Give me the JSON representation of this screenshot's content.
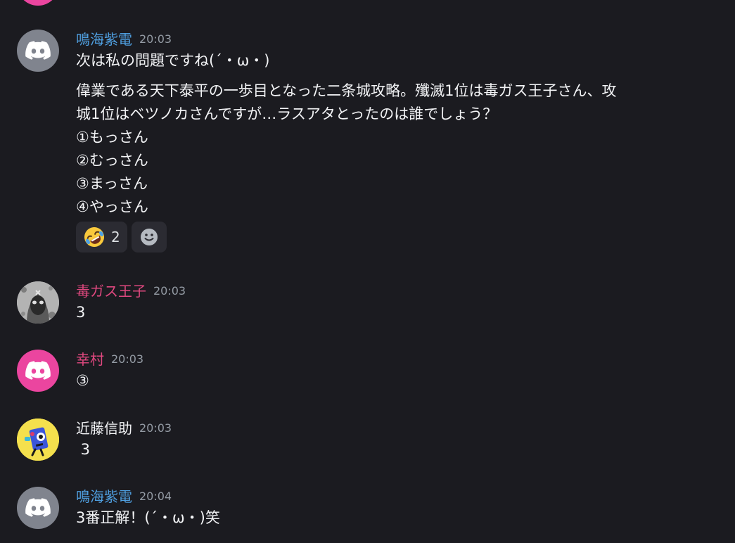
{
  "colors": {
    "background": "#1b1b20",
    "name_blue": "#4f9fe0",
    "name_pink": "#e0487f",
    "name_white": "#f2f3f5",
    "timestamp": "#949ba4",
    "avatar_gray": "#80848e",
    "avatar_pink": "#eb459f"
  },
  "messages": [
    {
      "author": "鳴海紫電",
      "time": "20:03",
      "avatar": "discord-logo-icon",
      "lines": [
        "次は私の問題ですね(´・ω・)"
      ],
      "lines2": [
        "偉業である天下泰平の一歩目となった二条城攻略。殲滅1位は毒ガス王子さん、攻",
        "城1位はベツノカさんですが…ラスアタとったのは誰でしょう？",
        "①もっさん",
        "②むっさん",
        "③まっさん",
        "④やっさん"
      ],
      "reactions": [
        {
          "emoji": "rolling-on-floor-laughing-emoji-icon",
          "count": "2"
        }
      ]
    },
    {
      "author": "毒ガス王子",
      "time": "20:03",
      "avatar": "masked-figure-avatar",
      "lines": [
        "3"
      ]
    },
    {
      "author": "幸村",
      "time": "20:03",
      "avatar": "discord-logo-icon",
      "lines": [
        "③"
      ]
    },
    {
      "author": "近藤信助",
      "time": "20:03",
      "avatar": "blue-robot-avatar",
      "lines": [
        " 3"
      ]
    },
    {
      "author": "鳴海紫電",
      "time": "20:04",
      "avatar": "discord-logo-icon",
      "lines": [
        "3番正解！(´・ω・)笑"
      ]
    }
  ]
}
